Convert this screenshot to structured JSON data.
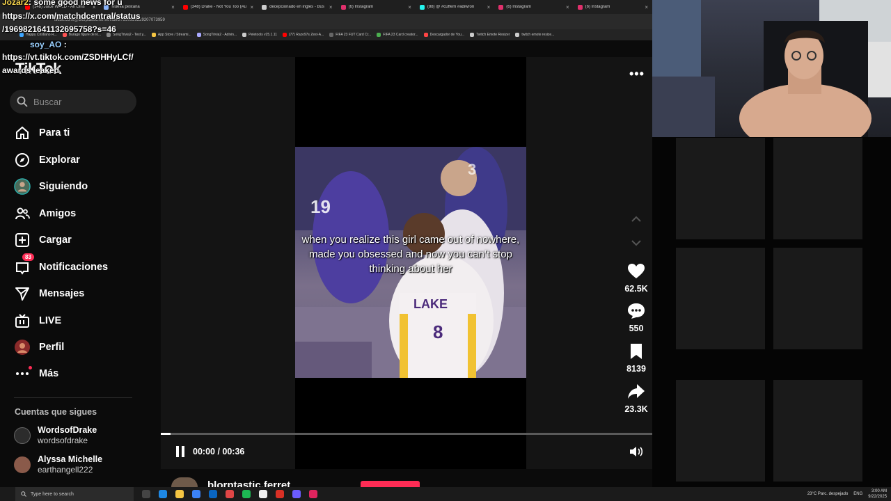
{
  "browser": {
    "tabs": [
      {
        "label": "(148) Juice WRLD - All Girls",
        "color": "#ff0000"
      },
      {
        "label": "Nueva pestaña",
        "color": "#8ab4f8"
      },
      {
        "label": "(348) Drake - Not You Too (Au",
        "color": "#ff0000"
      },
      {
        "label": "decepcionado en ingles - Bus",
        "color": "#cccccc"
      },
      {
        "label": "(6) Instagram",
        "color": "#e1306c"
      },
      {
        "label": "(88) @ #cuffem #adiwron",
        "color": "#25f4ee"
      },
      {
        "label": "(6) Instagram",
        "color": "#e1306c"
      },
      {
        "label": "(6) Instagram",
        "color": "#e1306c"
      }
    ],
    "url": "tiktok.com/@blorptastic.ferret/video/7550926229207073959",
    "bookmarks": [
      {
        "label": "Happy Cristiano R...",
        "color": "#3ea6ff"
      },
      {
        "label": "Burago figure de lo...",
        "color": "#ff5555"
      },
      {
        "label": "SongTrivia2 - Test y...",
        "color": "#888888"
      },
      {
        "label": "App Store / Streami...",
        "color": "#f5c542"
      },
      {
        "label": "SongTrivia2 - Adivin...",
        "color": "#aaaaff"
      },
      {
        "label": "Peletools v25.1.11",
        "color": "#cccccc"
      },
      {
        "label": "(77) Razo97s Zest-A...",
        "color": "#ff0000"
      },
      {
        "label": "FIFA 23 FUT Card Cr...",
        "color": "#666666"
      },
      {
        "label": "FIFA 23 Card creator...",
        "color": "#4caf50"
      },
      {
        "label": "Descargador de You...",
        "color": "#ff4444"
      },
      {
        "label": "Twitch Emote Resizer",
        "color": "#cccccc"
      },
      {
        "label": "twitch emote resize...",
        "color": "#cccccc"
      }
    ]
  },
  "chat": {
    "line1_user": "Jozar2",
    "line1_text": ": some good news for u",
    "line2": "https://x.com/matchdcentral/status",
    "line3": "/1969821641132695758?s=46",
    "line4_user": "soy_AO",
    "line4_text": " :",
    "line5": "https://vt.tiktok.com/ZSDHHyLCf/",
    "line6": "awards leaked"
  },
  "sidebar": {
    "logo": "TikTok",
    "search_placeholder": "Buscar",
    "items": [
      {
        "label": "Para ti",
        "icon": "home-icon"
      },
      {
        "label": "Explorar",
        "icon": "compass-icon"
      },
      {
        "label": "Siguiendo",
        "icon": "following-avatar-icon"
      },
      {
        "label": "Amigos",
        "icon": "friends-icon"
      },
      {
        "label": "Cargar",
        "icon": "upload-icon"
      },
      {
        "label": "Notificaciones",
        "icon": "inbox-icon",
        "badge": "83"
      },
      {
        "label": "Mensajes",
        "icon": "send-icon"
      },
      {
        "label": "LIVE",
        "icon": "live-icon"
      },
      {
        "label": "Perfil",
        "icon": "profile-icon"
      },
      {
        "label": "Más",
        "icon": "more-icon"
      }
    ],
    "following_title": "Cuentas que sigues",
    "accounts": [
      {
        "name": "WordsofDrake",
        "handle": "wordsofdrake"
      },
      {
        "name": "Alyssa Michelle",
        "handle": "earthangell222"
      }
    ]
  },
  "video": {
    "caption": "when you realize this girl came out of nowhere, made you obsessed and now you can’t stop thinking about her",
    "time": "00:00 / 00:36",
    "progress": 0.02,
    "likes": "62.5K",
    "comments": "550",
    "saves": "8139",
    "shares": "23.3K",
    "author": "blorptastic.ferret"
  },
  "taskbar": {
    "search_placeholder": "Type here to search",
    "weather": "23°C  Parc. despejado",
    "lang": "ENG",
    "time": "3:00 AM",
    "date": "9/22/2025"
  },
  "colors": {
    "accent": "#fe2c55",
    "background": "#0b0b0b",
    "chat_user": "#f5d34c"
  }
}
